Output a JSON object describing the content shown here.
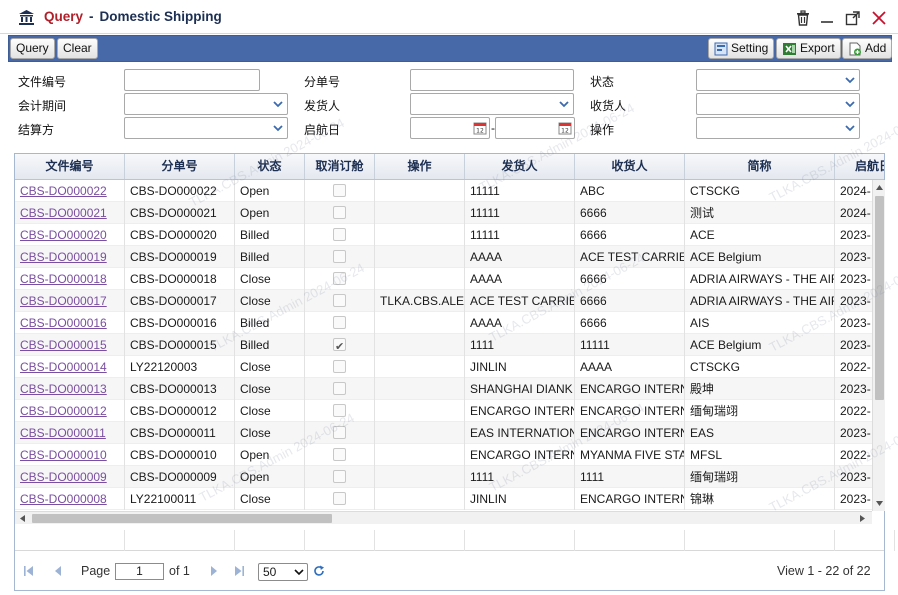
{
  "window": {
    "title_prefix": "Query",
    "title_sep": "-",
    "title_main": "Domestic Shipping"
  },
  "toolbar": {
    "query_label": "Query",
    "clear_label": "Clear",
    "setting_label": "Setting",
    "export_label": "Export",
    "add_label": "Add"
  },
  "filters": {
    "doc_no": "文件编号",
    "sub_no": "分单号",
    "status": "状态",
    "period": "会计期间",
    "shipper": "发货人",
    "consignee": "收货人",
    "settle": "结算方",
    "sail_date": "启航日",
    "operation": "操作"
  },
  "grid": {
    "columns": [
      "文件编号",
      "分单号",
      "状态",
      "取消订舱",
      "操作",
      "发货人",
      "收货人",
      "简称",
      "启航日"
    ],
    "rows": [
      [
        "CBS-DO000022",
        "CBS-DO000022",
        "Open",
        false,
        "",
        "11111",
        "ABC",
        "CTSCKG",
        "2024-"
      ],
      [
        "CBS-DO000021",
        "CBS-DO000021",
        "Open",
        false,
        "",
        "11111",
        "6666",
        "测试",
        "2024-"
      ],
      [
        "CBS-DO000020",
        "CBS-DO000020",
        "Billed",
        false,
        "",
        "11111",
        "6666",
        "ACE",
        "2023-"
      ],
      [
        "CBS-DO000019",
        "CBS-DO000019",
        "Billed",
        false,
        "",
        "AAAA",
        "ACE TEST CARRIE",
        "ACE Belgium",
        "2023-"
      ],
      [
        "CBS-DO000018",
        "CBS-DO000018",
        "Close",
        false,
        "",
        "AAAA",
        "6666",
        "ADRIA AIRWAYS - THE AIR",
        "2023-"
      ],
      [
        "CBS-DO000017",
        "CBS-DO000017",
        "Close",
        false,
        "TLKA.CBS.ALE",
        "ACE TEST CARRIE",
        "6666",
        "ADRIA AIRWAYS - THE AIR",
        "2023-"
      ],
      [
        "CBS-DO000016",
        "CBS-DO000016",
        "Billed",
        false,
        "",
        "AAAA",
        "6666",
        "AIS",
        "2023-"
      ],
      [
        "CBS-DO000015",
        "CBS-DO000015",
        "Billed",
        true,
        "",
        "1111",
        "11111",
        "ACE Belgium",
        "2023-"
      ],
      [
        "CBS-DO000014",
        "LY22120003",
        "Close",
        false,
        "",
        "JINLIN",
        "AAAA",
        "CTSCKG",
        "2022-"
      ],
      [
        "CBS-DO000013",
        "CBS-DO000013",
        "Close",
        false,
        "",
        "SHANGHAI DIANK",
        "ENCARGO INTERN",
        "殿坤",
        "2023-"
      ],
      [
        "CBS-DO000012",
        "CBS-DO000012",
        "Close",
        false,
        "",
        "ENCARGO INTERN",
        "ENCARGO INTERN",
        "缅甸瑞翊",
        "2022-"
      ],
      [
        "CBS-DO000011",
        "CBS-DO000011",
        "Close",
        false,
        "",
        "EAS INTERNATION",
        "ENCARGO INTERN",
        "EAS",
        "2023-"
      ],
      [
        "CBS-DO000010",
        "CBS-DO000010",
        "Open",
        false,
        "",
        "ENCARGO INTERN",
        "MYANMA FIVE STA",
        "MFSL",
        "2022-"
      ],
      [
        "CBS-DO000009",
        "CBS-DO000009",
        "Open",
        false,
        "",
        "1111",
        "1111",
        "缅甸瑞翊",
        "2023-"
      ],
      [
        "CBS-DO000008",
        "LY22100011",
        "Close",
        false,
        "",
        "JINLIN",
        "ENCARGO INTERN",
        "锦琳",
        "2023-"
      ]
    ]
  },
  "pager": {
    "page_label": "Page",
    "page_value": "1",
    "of_label": "of 1",
    "page_size": "50",
    "summary": "View 1 - 22 of 22"
  },
  "watermarks": [
    "TLKA.CBS.Admin 2024-06-24"
  ]
}
